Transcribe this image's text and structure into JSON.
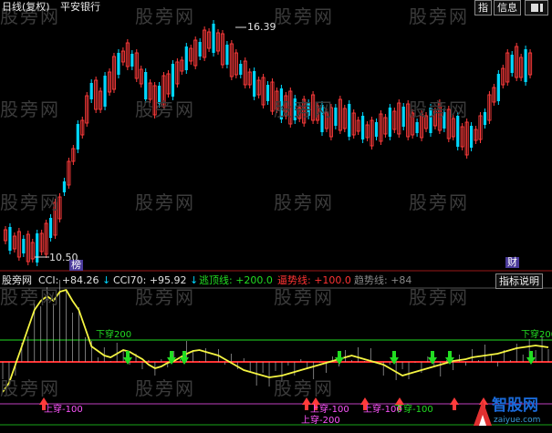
{
  "header": {
    "period": "日线(复权)",
    "stock": "平安银行",
    "buttons": [
      "指",
      "信息"
    ]
  },
  "watermark": "股旁网",
  "price_chart": {
    "high_label": "16.39",
    "low_label": "10.50",
    "tags": [
      "榜",
      "财"
    ]
  },
  "indicator_bar": {
    "name": "股旁网",
    "items": [
      {
        "label": "CCI:",
        "value": "+84.26",
        "arrow": "↓",
        "color": "#e0e0e0"
      },
      {
        "label": "CCI70:",
        "value": "+95.92",
        "arrow": "↓",
        "color": "#e0e0e0"
      },
      {
        "label": "逃顶线:",
        "value": "+200.0",
        "arrow": "",
        "color": "#22dd22"
      },
      {
        "label": "逼势线:",
        "value": "+100.0",
        "arrow": "",
        "color": "#ff3333"
      },
      {
        "label": "趋势线:",
        "value": "+84",
        "arrow": "",
        "color": "#888888"
      }
    ],
    "explain_button": "指标说明"
  },
  "indicator_chart": {
    "labels": {
      "down200_a": "下穿200",
      "down200_b": "下穿200",
      "up_m100_a": "上穿-100",
      "up_m100_b": "上穿-100",
      "up_m100_c": "上穿-100",
      "up_m200": "上穿-200",
      "down_m100": "下穿-100"
    }
  },
  "logo": {
    "name": "智股网",
    "url": "zaiyue.com"
  },
  "colors": {
    "up": "#ff3b3b",
    "down": "#00d7ff",
    "green": "#22dd22",
    "red": "#ff3333",
    "yellow": "#f5f542"
  }
}
